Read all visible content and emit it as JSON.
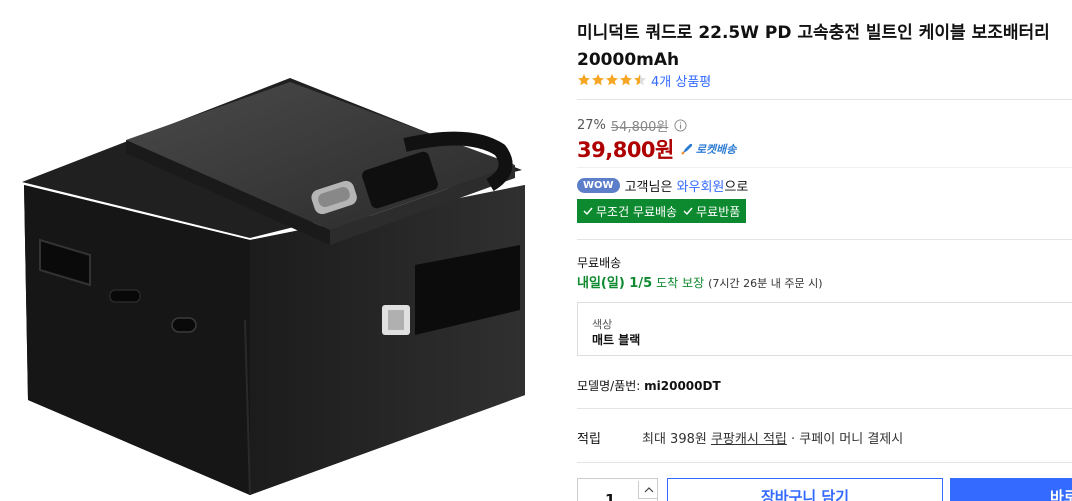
{
  "product": {
    "title_line1": "미니덕트 쿼드로 22.5W PD 고속충전 빌트인 케이블 보조배터리",
    "title_line2": "20000mAh",
    "image_alt": "product-image",
    "rating": 4.5,
    "rating_max": 5,
    "review_count_label": "4개 상품평"
  },
  "price": {
    "discount_rate": "27%",
    "original_price": "54,800원",
    "sale_price": "39,800원",
    "rocket_label": "로켓배송"
  },
  "wow": {
    "badge": "WOW",
    "text_before": "고객님은",
    "member_link": "와우회원",
    "text_after": "으로"
  },
  "benefits": {
    "free_shipping": "무조건 무료배송",
    "free_return": "무료반품"
  },
  "shipping": {
    "title": "무료배송",
    "date": "내일(일) 1/5",
    "guarantee": "도착 보장",
    "note": "(7시간 26분 내 주문 시)"
  },
  "option": {
    "label": "색상",
    "value": "매트 블랙"
  },
  "model": {
    "label": "모델명/품번:",
    "value": "mi20000DT"
  },
  "points": {
    "label": "적립",
    "prefix": "최대 398원",
    "link": "쿠팡캐시 적립",
    "suffix": "· 쿠페이 머니 결제시"
  },
  "purchase": {
    "quantity": "1",
    "cart_label": "장바구니 담기",
    "buy_label": "바로구매"
  },
  "colors": {
    "accent_blue": "#346aff",
    "price_red": "#ae0000",
    "green": "#0d8a2f",
    "star": "#f5a623"
  }
}
